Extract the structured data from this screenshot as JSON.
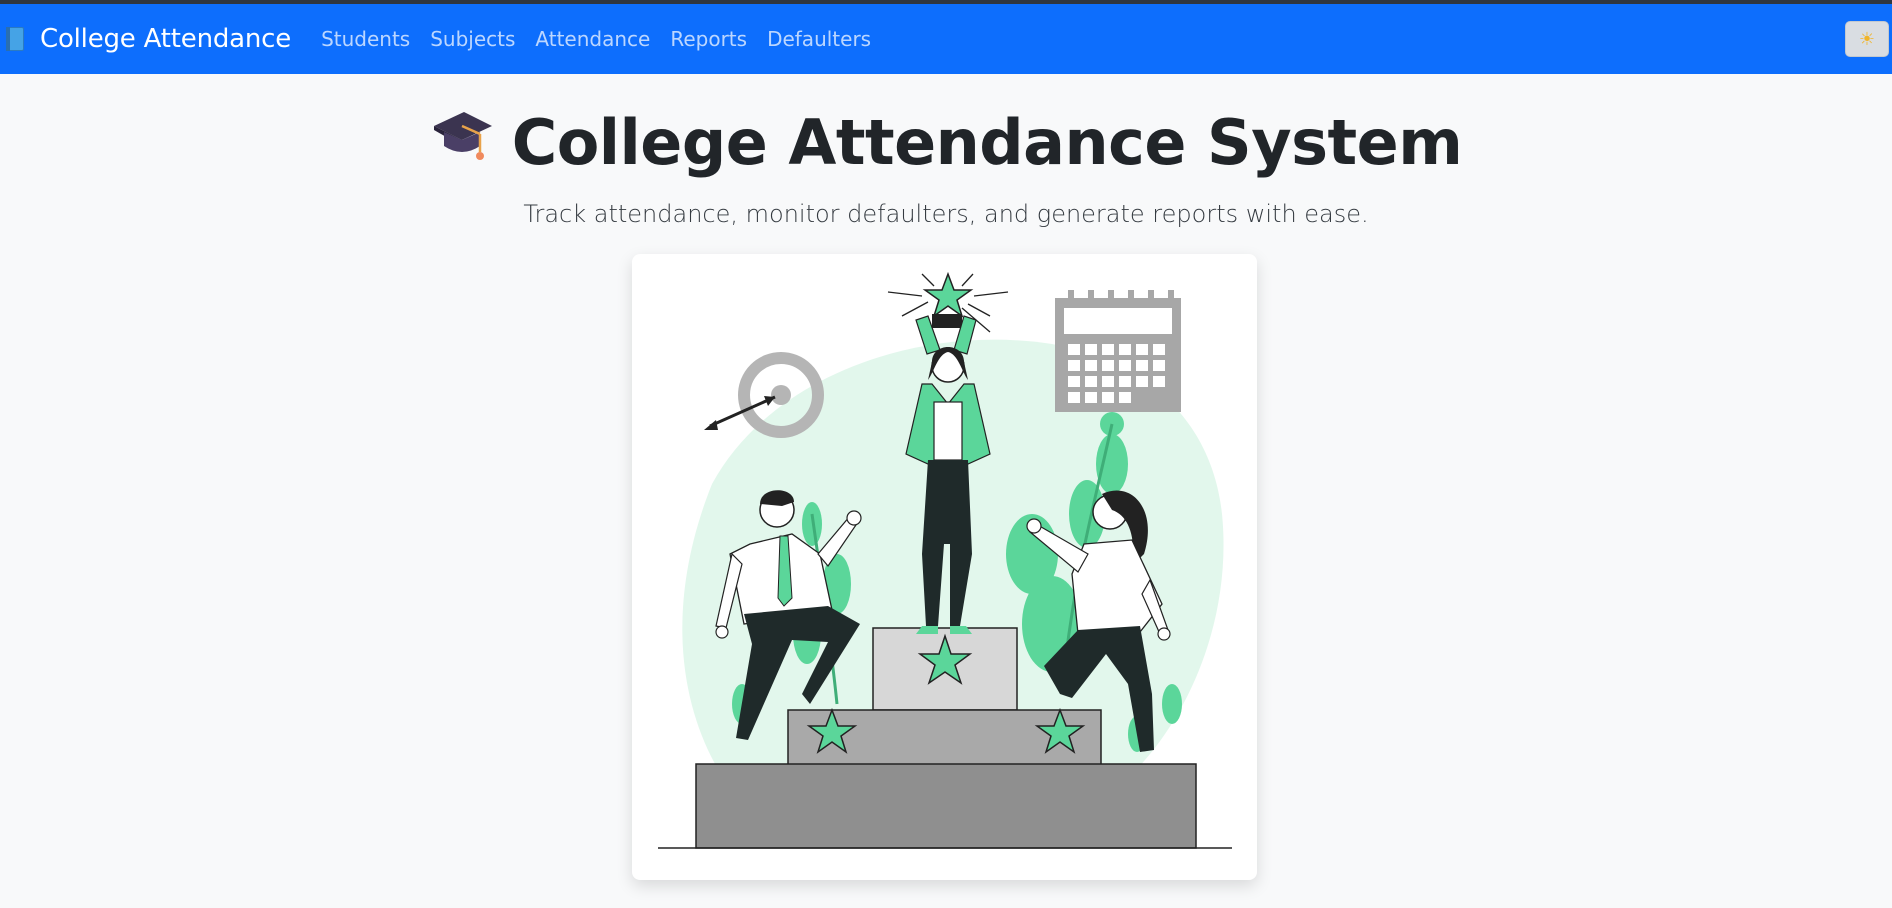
{
  "navbar": {
    "brand": "College Attendance",
    "links": [
      "Students",
      "Subjects",
      "Attendance",
      "Reports",
      "Defaulters"
    ],
    "toggle_icon": "sun-icon"
  },
  "hero": {
    "title": "College Attendance System",
    "subtitle": "Track attendance, monitor defaulters, and generate reports with ease.",
    "title_icon": "graduation-cap-icon"
  },
  "illustration": {
    "description_icon": "podium-celebration-illustration"
  },
  "colors": {
    "navbar": "#0d6efd",
    "accent_green": "#5bd69a",
    "background": "#f8f9fa"
  }
}
